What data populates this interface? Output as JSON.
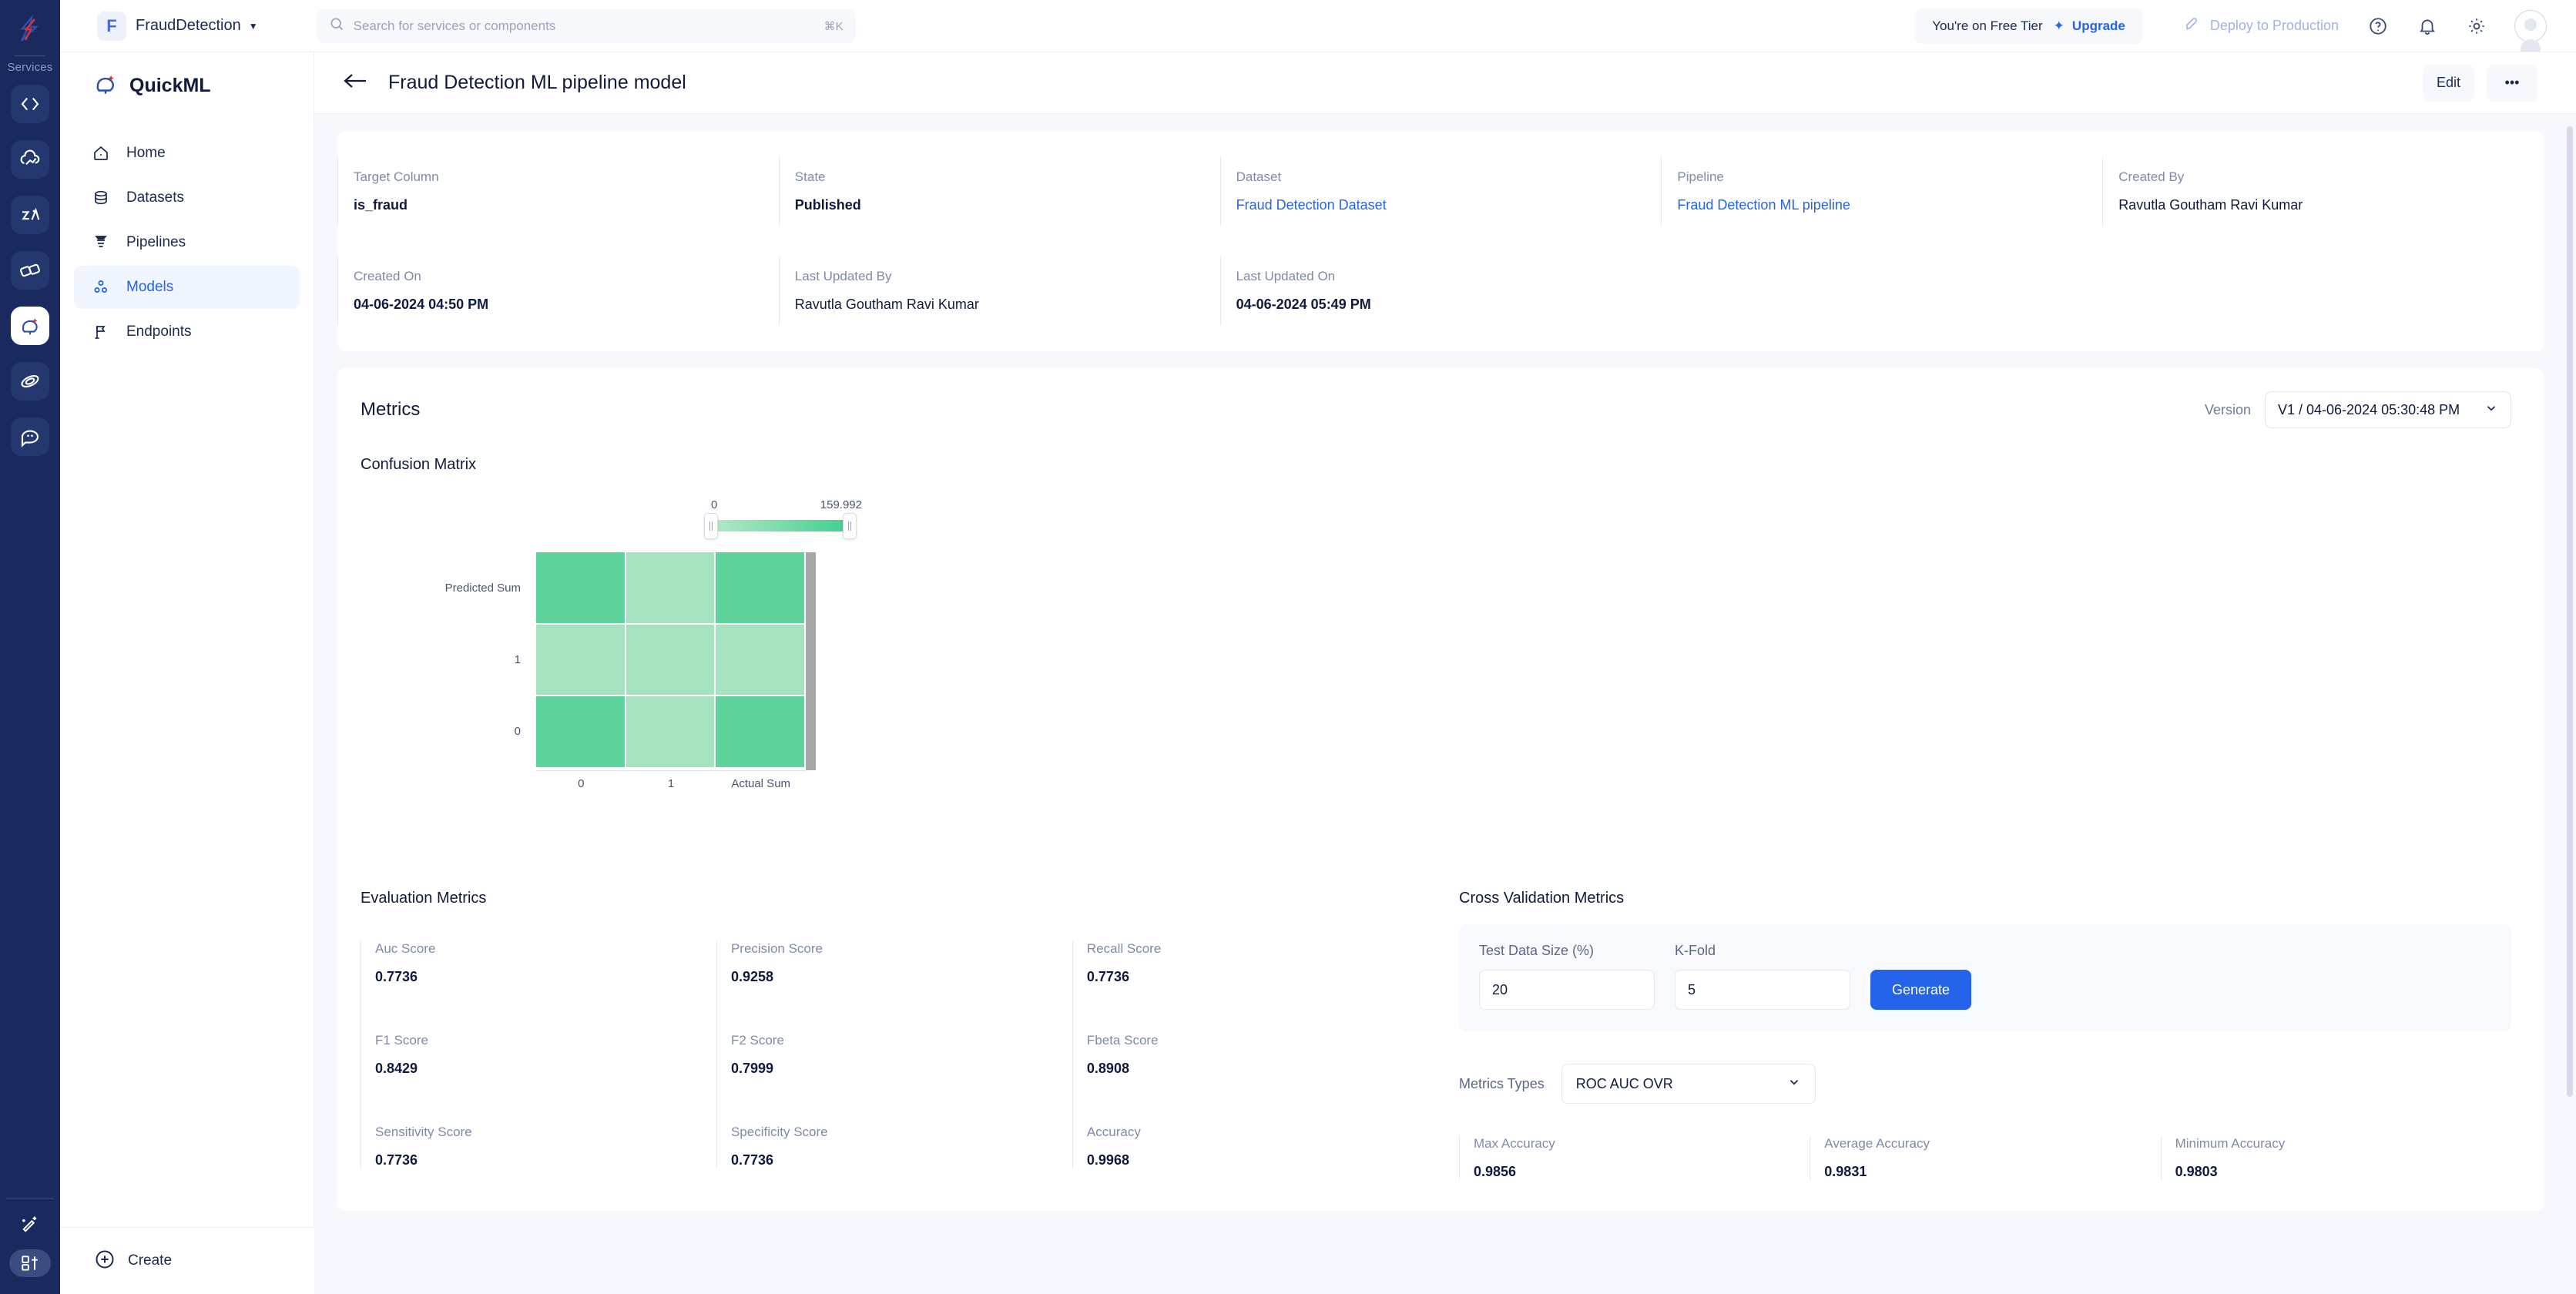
{
  "topbar": {
    "org_initial": "F",
    "org_name": "FraudDetection",
    "search_placeholder": "Search for services or components",
    "search_shortcut": "⌘K",
    "tier_text": "You're on Free Tier",
    "upgrade_label": "Upgrade",
    "deploy_label": "Deploy to Production",
    "icons": [
      "help-circle-icon",
      "bell-icon",
      "gear-icon",
      "avatar"
    ]
  },
  "rail": {
    "services_label": "Services",
    "items": [
      "code-service-icon",
      "cloud-data-icon",
      "analytics-icon",
      "link-service-icon",
      "quickml-icon",
      "orbit-icon",
      "chat-service-icon"
    ],
    "bottom_items": [
      "magic-wand-icon",
      "apps-grid-icon"
    ]
  },
  "sidebar": {
    "brand": "QuickML",
    "items": [
      {
        "label": "Home",
        "icon": "home-icon",
        "active": false
      },
      {
        "label": "Datasets",
        "icon": "database-icon",
        "active": false
      },
      {
        "label": "Pipelines",
        "icon": "funnel-icon",
        "active": false
      },
      {
        "label": "Models",
        "icon": "models-icon",
        "active": true
      },
      {
        "label": "Endpoints",
        "icon": "flag-icon",
        "active": false
      }
    ],
    "create_label": "Create"
  },
  "page": {
    "title": "Fraud Detection ML pipeline model",
    "back_icon": "arrow-left-icon",
    "edit_label": "Edit",
    "more_label": "•••"
  },
  "meta": {
    "row1": [
      {
        "label": "Target Column",
        "value": "is_fraud",
        "type": "bold"
      },
      {
        "label": "State",
        "value": "Published",
        "type": "bold"
      },
      {
        "label": "Dataset",
        "value": "Fraud Detection Dataset",
        "type": "link"
      },
      {
        "label": "Pipeline",
        "value": "Fraud Detection ML pipeline",
        "type": "link"
      },
      {
        "label": "Created By",
        "value": "Ravutla Goutham Ravi Kumar",
        "type": "normal"
      }
    ],
    "row2": [
      {
        "label": "Created On",
        "value": "04-06-2024 04:50 PM",
        "type": "bold"
      },
      {
        "label": "Last Updated By",
        "value": "Ravutla Goutham Ravi Kumar",
        "type": "normal"
      },
      {
        "label": "Last Updated On",
        "value": "04-06-2024 05:49 PM",
        "type": "bold"
      }
    ]
  },
  "metrics": {
    "title": "Metrics",
    "version_label": "Version",
    "version_value": "V1 / 04-06-2024 05:30:48 PM",
    "confusion_matrix_title": "Confusion Matrix",
    "evaluation_title": "Evaluation Metrics",
    "cross_validation_title": "Cross Validation Metrics"
  },
  "chart_data": {
    "type": "heatmap",
    "title": "Confusion Matrix",
    "xlabel": "",
    "ylabel": "",
    "x_ticks": [
      "0",
      "1",
      "Actual Sum"
    ],
    "y_ticks": [
      "Predicted Sum",
      "1",
      "0"
    ],
    "colorbar": {
      "min": "0",
      "max": "159.992",
      "colors": [
        "#b7e8c8",
        "#3ecf8e"
      ]
    },
    "cells": [
      {
        "row": "Predicted Sum",
        "col": "0",
        "color": "#5ed39b"
      },
      {
        "row": "Predicted Sum",
        "col": "1",
        "color": "#a5e3c0"
      },
      {
        "row": "Predicted Sum",
        "col": "Actual Sum",
        "color": "#5ed39b"
      },
      {
        "row": "1",
        "col": "0",
        "color": "#a5e3c0"
      },
      {
        "row": "1",
        "col": "1",
        "color": "#a5e3c0"
      },
      {
        "row": "1",
        "col": "Actual Sum",
        "color": "#a5e3c0"
      },
      {
        "row": "0",
        "col": "0",
        "color": "#5ed39b"
      },
      {
        "row": "0",
        "col": "1",
        "color": "#a5e3c0"
      },
      {
        "row": "0",
        "col": "Actual Sum",
        "color": "#5ed39b"
      }
    ]
  },
  "evaluation_scores": [
    {
      "label": "Auc Score",
      "value": "0.7736"
    },
    {
      "label": "Precision Score",
      "value": "0.9258"
    },
    {
      "label": "Recall Score",
      "value": "0.7736"
    },
    {
      "label": "F1 Score",
      "value": "0.8429"
    },
    {
      "label": "F2 Score",
      "value": "0.7999"
    },
    {
      "label": "Fbeta Score",
      "value": "0.8908"
    },
    {
      "label": "Sensitivity Score",
      "value": "0.7736"
    },
    {
      "label": "Specificity Score",
      "value": "0.7736"
    },
    {
      "label": "Accuracy",
      "value": "0.9968"
    }
  ],
  "cross_validation": {
    "test_data_size_label": "Test Data Size (%)",
    "test_data_size_value": "20",
    "k_fold_label": "K-Fold",
    "k_fold_value": "5",
    "generate_label": "Generate",
    "metrics_types_label": "Metrics Types",
    "metrics_types_value": "ROC AUC OVR",
    "scores": [
      {
        "label": "Max Accuracy",
        "value": "0.9856"
      },
      {
        "label": "Average Accuracy",
        "value": "0.9831"
      },
      {
        "label": "Minimum Accuracy",
        "value": "0.9803"
      }
    ]
  },
  "colors": {
    "accent": "#2563eb",
    "rail_bg": "#1b2a5e",
    "heat_light": "#a5e3c0",
    "heat_dark": "#5ed39b"
  }
}
